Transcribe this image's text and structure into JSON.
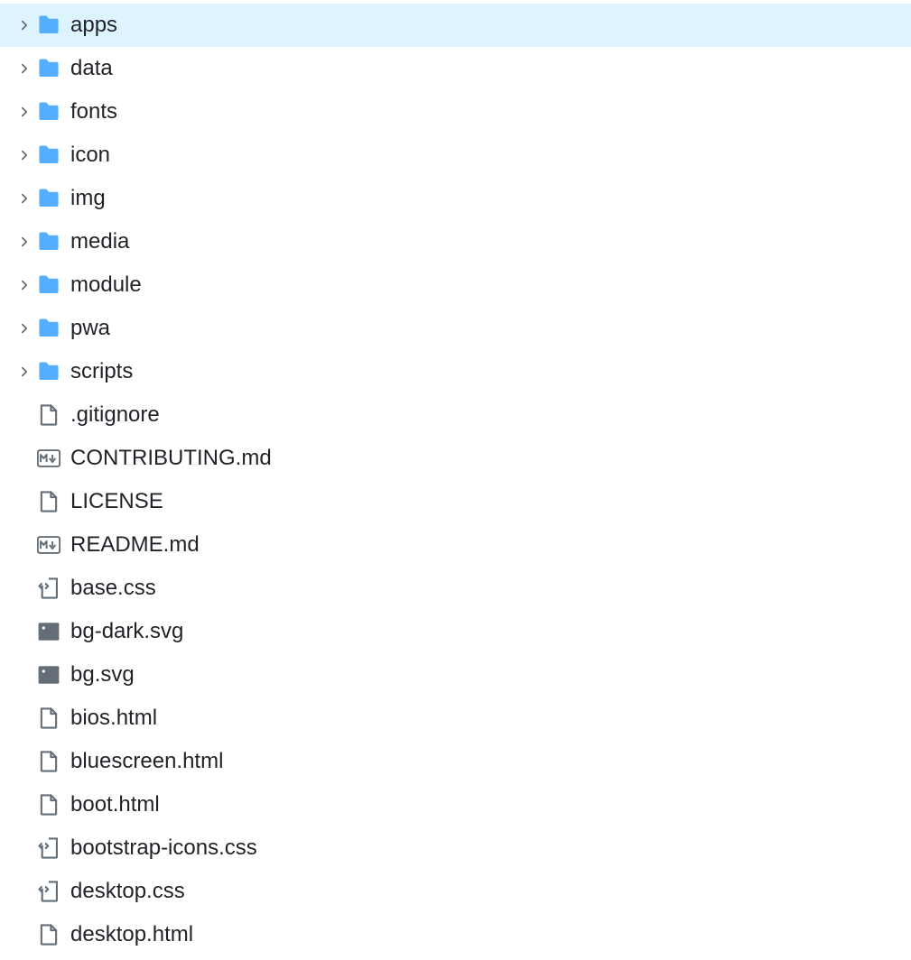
{
  "items": [
    {
      "name": "apps",
      "type": "folder",
      "selected": true
    },
    {
      "name": "data",
      "type": "folder",
      "selected": false
    },
    {
      "name": "fonts",
      "type": "folder",
      "selected": false
    },
    {
      "name": "icon",
      "type": "folder",
      "selected": false
    },
    {
      "name": "img",
      "type": "folder",
      "selected": false
    },
    {
      "name": "media",
      "type": "folder",
      "selected": false
    },
    {
      "name": "module",
      "type": "folder",
      "selected": false
    },
    {
      "name": "pwa",
      "type": "folder",
      "selected": false
    },
    {
      "name": "scripts",
      "type": "folder",
      "selected": false
    },
    {
      "name": ".gitignore",
      "type": "file",
      "selected": false
    },
    {
      "name": "CONTRIBUTING.md",
      "type": "markdown",
      "selected": false
    },
    {
      "name": "LICENSE",
      "type": "file",
      "selected": false
    },
    {
      "name": "README.md",
      "type": "markdown",
      "selected": false
    },
    {
      "name": "base.css",
      "type": "css",
      "selected": false
    },
    {
      "name": "bg-dark.svg",
      "type": "image",
      "selected": false
    },
    {
      "name": "bg.svg",
      "type": "image",
      "selected": false
    },
    {
      "name": "bios.html",
      "type": "file",
      "selected": false
    },
    {
      "name": "bluescreen.html",
      "type": "file",
      "selected": false
    },
    {
      "name": "boot.html",
      "type": "file",
      "selected": false
    },
    {
      "name": "bootstrap-icons.css",
      "type": "css",
      "selected": false
    },
    {
      "name": "desktop.css",
      "type": "css",
      "selected": false
    },
    {
      "name": "desktop.html",
      "type": "file",
      "selected": false
    }
  ]
}
